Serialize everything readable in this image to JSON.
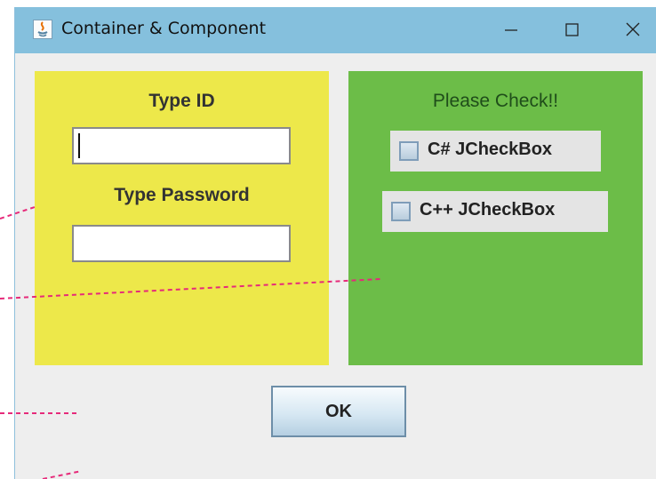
{
  "window": {
    "title": "Container & Component"
  },
  "titlebar_buttons": [
    {
      "name": "minimize",
      "icon": "minimize-icon"
    },
    {
      "name": "maximize",
      "icon": "maximize-icon"
    },
    {
      "name": "close",
      "icon": "close-icon"
    }
  ],
  "left_panel": {
    "color": "#ede84a",
    "id_label": "Type ID",
    "id_value": "",
    "password_label": "Type Password",
    "password_value": ""
  },
  "right_panel": {
    "color": "#6cbd48",
    "heading": "Please Check!!",
    "checkboxes": [
      {
        "label": "C# JCheckBox",
        "checked": false
      },
      {
        "label": "C++ JCheckBox",
        "checked": false
      }
    ]
  },
  "ok_button": {
    "label": "OK"
  },
  "colors": {
    "titlebar": "#85c0dd",
    "annotation_lines": "#e62a7a"
  }
}
